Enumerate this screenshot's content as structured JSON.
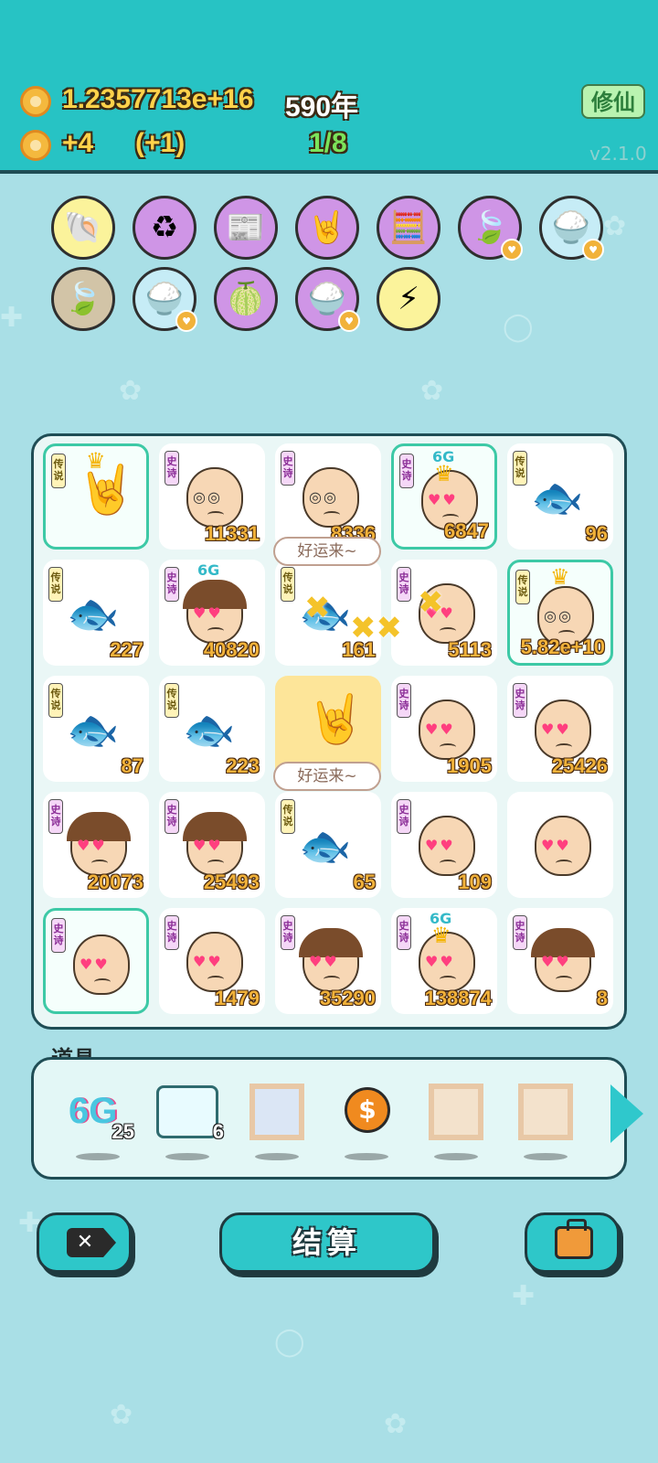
{
  "header": {
    "coins": "1.2357713e+16",
    "years": "590年",
    "income": "+4",
    "income_bonus": "(+1)",
    "progress": "1/8",
    "version": "v2.1.0",
    "cultivate_label": "修仙"
  },
  "buffs": [
    {
      "icon": "shell-icon",
      "glyph": "🐚",
      "bg": "#fbf39b"
    },
    {
      "icon": "recycle-icon",
      "glyph": "♻",
      "bg": "#cf95e6"
    },
    {
      "icon": "time-magazine-icon",
      "glyph": "📰",
      "bg": "#cf95e6"
    },
    {
      "icon": "rock-hand-icon",
      "glyph": "🤘",
      "bg": "#cf95e6"
    },
    {
      "icon": "math-head-icon",
      "glyph": "🧮",
      "bg": "#cf95e6"
    },
    {
      "icon": "leaf-icon",
      "glyph": "🍃",
      "bg": "#cf95e6"
    },
    {
      "icon": "rice-bowl-icon",
      "glyph": "🍚",
      "bg": "#c6ecf6"
    },
    {
      "icon": "leaf-icon",
      "glyph": "🍃",
      "bg": "#d2c4a7"
    },
    {
      "icon": "rice-bowl-icon",
      "glyph": "🍚",
      "bg": "#c6ecf6"
    },
    {
      "icon": "pomelo-icon",
      "glyph": "🍈",
      "bg": "#cf95e6"
    },
    {
      "icon": "rice-bowl-icon",
      "glyph": "🍚",
      "bg": "#cf95e6"
    },
    {
      "icon": "lightning-icon",
      "glyph": "⚡",
      "bg": "#fbf39b"
    }
  ],
  "tags": {
    "legend": "传说",
    "epic": "史诗"
  },
  "board": [
    {
      "tag": "legend",
      "kind": "hand",
      "value": "",
      "crown": true
    },
    {
      "tag": "epic",
      "kind": "bald-glasses",
      "value": "11331"
    },
    {
      "tag": "epic",
      "kind": "bald-glasses",
      "value": "8336"
    },
    {
      "tag": "epic",
      "kind": "bald-hearts",
      "value": "6847",
      "badge": "6G",
      "crown": true
    },
    {
      "tag": "legend",
      "kind": "fish",
      "value": "96"
    },
    {
      "tag": "legend",
      "kind": "fish",
      "value": "227"
    },
    {
      "tag": "epic",
      "kind": "girl-hearts",
      "value": "40820",
      "badge": "6G"
    },
    {
      "tag": "legend",
      "kind": "fish",
      "value": "161"
    },
    {
      "tag": "epic",
      "kind": "bald-hearts",
      "value": "5113"
    },
    {
      "tag": "legend",
      "kind": "bald-glasses",
      "value": "5.82e+10",
      "crown": true
    },
    {
      "tag": "legend",
      "kind": "fish",
      "value": "87"
    },
    {
      "tag": "legend",
      "kind": "fish",
      "value": "223"
    },
    {
      "tag": "",
      "kind": "hand",
      "value": ""
    },
    {
      "tag": "epic",
      "kind": "bald-hearts",
      "value": "1905"
    },
    {
      "tag": "epic",
      "kind": "bald-hearts",
      "value": "25426"
    },
    {
      "tag": "epic",
      "kind": "girl-hearts",
      "value": "20073"
    },
    {
      "tag": "epic",
      "kind": "girl-hearts",
      "value": "25493"
    },
    {
      "tag": "legend",
      "kind": "fish",
      "value": "65"
    },
    {
      "tag": "epic",
      "kind": "bald-hearts",
      "value": "109"
    },
    {
      "tag": "",
      "kind": "bald-hearts",
      "value": ""
    },
    {
      "tag": "epic",
      "kind": "bald-hearts",
      "value": ""
    },
    {
      "tag": "epic",
      "kind": "bald-hearts",
      "value": "1479"
    },
    {
      "tag": "epic",
      "kind": "girl-hearts",
      "value": "35290"
    },
    {
      "tag": "epic",
      "kind": "bald-hearts",
      "value": "138874",
      "badge": "6G",
      "crown": true
    },
    {
      "tag": "epic",
      "kind": "girl-hearts",
      "value": "8"
    }
  ],
  "bubbles": [
    "好运来~",
    "好运来~"
  ],
  "props": {
    "label": "道具",
    "items": [
      {
        "icon": "6g-icon",
        "text": "6G",
        "count": "25"
      },
      {
        "icon": "battery-icon",
        "text": "",
        "count": "6"
      },
      {
        "icon": "framed-card-icon",
        "text": "",
        "count": ""
      },
      {
        "icon": "dollar-coin-icon",
        "text": "$",
        "count": ""
      },
      {
        "icon": "empty-frame-icon",
        "text": "",
        "count": ""
      },
      {
        "icon": "empty-frame-icon",
        "text": "",
        "count": ""
      }
    ]
  },
  "buttons": {
    "settle": "结算",
    "close_icon": "close-tag-icon",
    "bag_icon": "briefcase-icon"
  }
}
